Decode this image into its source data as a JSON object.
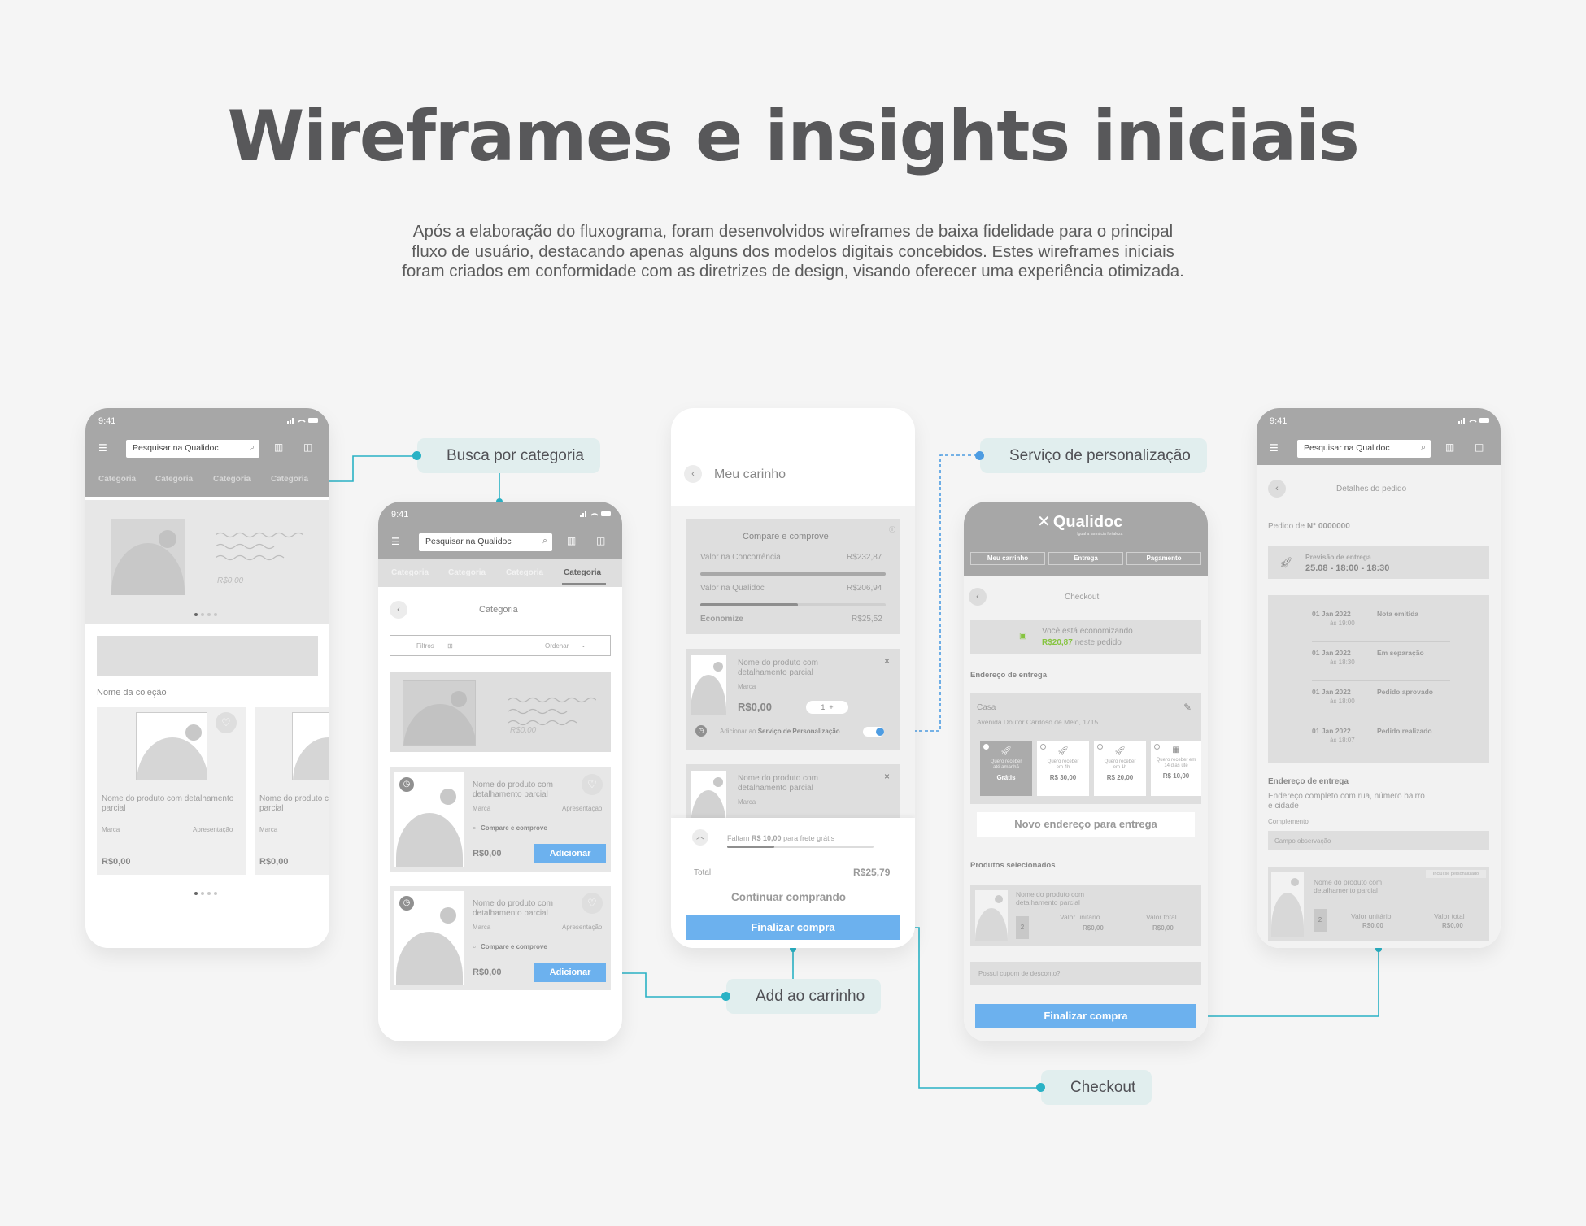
{
  "page": {
    "title": "Wireframes e insights iniciais",
    "intro": [
      "Após a elaboração do fluxograma, foram desenvolvidos wireframes de baixa fidelidade para o principal",
      "fluxo de usuário, destacando apenas alguns dos modelos digitais concebidos. Estes wireframes iniciais",
      "foram criados em conformidade com as diretrizes de design, visando oferecer uma experiência otimizada."
    ]
  },
  "labels": {
    "busca": "Busca por categoria",
    "servico": "Serviço de personalização",
    "add": "Add ao carrinho",
    "checkout": "Checkout"
  },
  "colors": {
    "connector_teal": "#2ab2c5",
    "connector_blue": "#4d9ce2",
    "button_blue": "#6cb1ee"
  },
  "phone1": {
    "time": "9:41",
    "search": "Pesquisar na Qualidoc",
    "categories": [
      "Categoria",
      "Categoria",
      "Categoria",
      "Categoria"
    ],
    "banner_price": "R$0,00",
    "collection": "Nome da coleção",
    "product_name": "Nome do produto com detalhamento parcial",
    "product_name_short": "Nome do produto c parcial",
    "brand": "Marca",
    "presentation": "Apresentação",
    "price": "R$0,00"
  },
  "phone2": {
    "time": "9:41",
    "search": "Pesquisar na Qualidoc",
    "categories": [
      "Categoria",
      "Categoria",
      "Categoria",
      "Categoria"
    ],
    "title": "Categoria",
    "filters": "Filtros",
    "order": "Ordenar",
    "banner_price": "R$0,00",
    "product_name": "Nome do produto com detalhamento parcial",
    "brand": "Marca",
    "presentation": "Apresentação",
    "compare": "Compare e comprove",
    "price": "R$0,00",
    "add": "Adicionar"
  },
  "phone3": {
    "title": "Meu carinho",
    "compare_title": "Compare e comprove",
    "competitor_label": "Valor na Concorrência",
    "competitor_value": "R$232,87",
    "qualidoc_label": "Valor na Qualidoc",
    "qualidoc_value": "R$206,94",
    "save_label": "Economize",
    "save_value": "R$25,52",
    "product_name": "Nome do produto com detalhamento parcial",
    "brand": "Marca",
    "price": "R$0,00",
    "qty": "1",
    "personalize": "Adicionar ao",
    "personalize_bold": "Serviço de Personalização",
    "shipping_pre": "Faltam",
    "shipping_bold": "R$ 10,00",
    "shipping_post": "para frete grátis",
    "total_label": "Total",
    "total_value": "R$25,79",
    "continue": "Continuar comprando",
    "finish": "Finalizar compra"
  },
  "phone4": {
    "brand": "Qualidoc",
    "tagline": "Igual a farmácia fortaleza",
    "steps": [
      "Meu carrinho",
      "Entrega",
      "Pagamento"
    ],
    "title": "Checkout",
    "saving_line": "Você está economizando",
    "saving_value": "R$20,87",
    "saving_post": "neste pedido",
    "address_section": "Endereço de entrega",
    "address_name": "Casa",
    "address_line": "Avenida Doutor Cardoso de Melo, 1715",
    "options": [
      {
        "text": "Quero receber até amanhã",
        "price": "Grátis"
      },
      {
        "text": "Quero receber em 4h",
        "price": "R$ 30,00"
      },
      {
        "text": "Quero receber em 1h",
        "price": "R$ 20,00"
      },
      {
        "text": "Quero receber em 14 dias úte",
        "price": "R$ 10,00"
      }
    ],
    "new_address": "Novo endereço para entrega",
    "products_section": "Produtos selecionados",
    "product_name": "Nome do produto com detalhamento parcial",
    "unit_label": "Valor unitário",
    "unit_value": "R$0,00",
    "total_label": "Valor total",
    "total_value": "R$0,00",
    "qty": "2",
    "coupon": "Possui cupom de desconto?",
    "finish": "Finalizar compra"
  },
  "phone5": {
    "time": "9:41",
    "search": "Pesquisar na Qualidoc",
    "title": "Detalhes do pedido",
    "order_prefix": "Pedido de",
    "order_number": "N° 0000000",
    "delivery_label": "Previsão de entrega",
    "delivery_value": "25.08 - 18:00 - 18:30",
    "timeline": [
      {
        "date": "01 Jan 2022",
        "time": "às 19:00",
        "status": "Nota emitida"
      },
      {
        "date": "01 Jan 2022",
        "time": "às 18:30",
        "status": "Em separação"
      },
      {
        "date": "01 Jan 2022",
        "time": "às 18:00",
        "status": "Pedido aprovado"
      },
      {
        "date": "01 Jan 2022",
        "time": "às 18:07",
        "status": "Pedido realizado"
      }
    ],
    "address_title": "Endereço de entrega",
    "address_text": "Endereço completo com rua, número bairro e cidade",
    "complement": "Complemento",
    "observation": "Campo observação",
    "personalize_tag": "Incluí se personalizado",
    "product_name": "Nome do produto com detalhamento parcial",
    "unit_label": "Valor unitário",
    "unit_value": "R$0,00",
    "total_label": "Valor total",
    "total_value": "R$0,00",
    "qty": "2"
  }
}
